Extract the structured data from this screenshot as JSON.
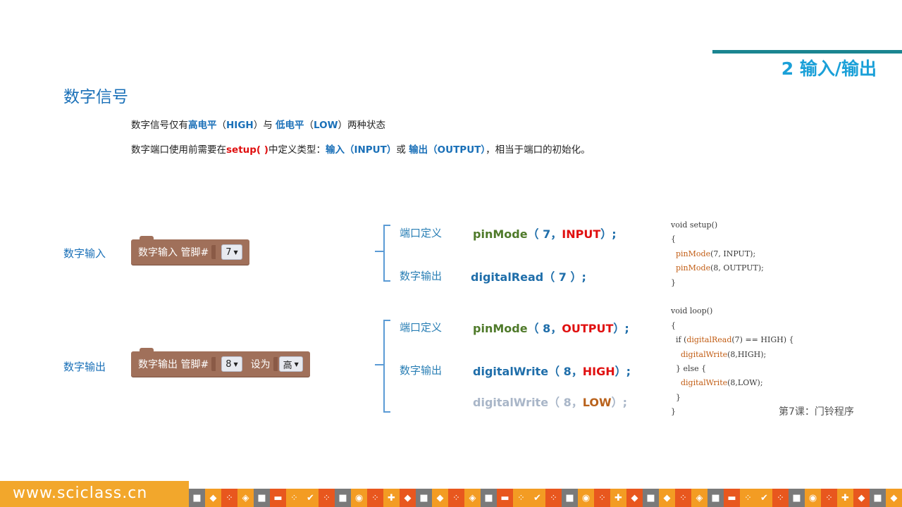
{
  "header": {
    "section": "2 输入/输出",
    "title": "数字信号"
  },
  "paragraphs": {
    "p1": {
      "a": "数字信号仅有",
      "b": "高电平",
      "c": "（",
      "d": "HIGH",
      "e": "）与 ",
      "f": "低电平",
      "g": "（",
      "h": "LOW",
      "i": "）两种状态"
    },
    "p2": {
      "a": "数字端口使用前需要在",
      "b": "setup( )",
      "c": "中定义类型：",
      "d": "输入（INPUT）",
      "e": "或 ",
      "f": "输出（OUTPUT）",
      "g": "，相当于端口的初始化。"
    }
  },
  "input_row": {
    "label": "数字输入",
    "block_text": "数字输入 管脚#",
    "pin": "7",
    "def_label": "端口定义",
    "def_code": {
      "fn": "pinMode",
      "open": "（ 7，",
      "arg": "INPUT",
      "close": "）;"
    },
    "io_label": "数字输出",
    "io_code": {
      "fn": "digitalRead",
      "rest": "（ 7 ）;"
    }
  },
  "output_row": {
    "label": "数字输出",
    "block_text": "数字输出 管脚#",
    "pin": "8",
    "set_text": "设为",
    "value": "高",
    "def_label": "端口定义",
    "def_code": {
      "fn": "pinMode",
      "open": "（ 8，",
      "arg": "OUTPUT",
      "close": "）;"
    },
    "io_label": "数字输出",
    "io_code": {
      "fn": "digitalWrite",
      "open": "（ 8，",
      "arg": "HIGH",
      "close": "）;"
    },
    "io_code2": {
      "fn": "digitalWrite",
      "open": "（ 8，",
      "arg": "LOW",
      "close": "）;"
    }
  },
  "code_panel": {
    "l1": "void setup()",
    "l2": "{",
    "l3a": "  ",
    "l3fn": "pinMode",
    "l3b": "(7, INPUT);",
    "l4a": "  ",
    "l4fn": "pinMode",
    "l4b": "(8, OUTPUT);",
    "l5": "}",
    "l6": "",
    "l7": "void loop()",
    "l8": "{",
    "l9a": "  if (",
    "l9fn": "digitalRead",
    "l9b": "(7) == HIGH) {",
    "l10a": "    ",
    "l10fn": "digitalWrite",
    "l10b": "(8,HIGH);",
    "l11": "  } else {",
    "l12a": "    ",
    "l12fn": "digitalWrite",
    "l12b": "(8,LOW);",
    "l13": "  }",
    "l14": "}"
  },
  "lesson": "第7课：门铃程序",
  "footer": {
    "site": "www.sciclass.cn"
  },
  "colors": {
    "accent": "#1aa0d8",
    "title_blue": "#1a70b8",
    "red": "#e01010",
    "green": "#4f7a2a",
    "block": "#a0705a",
    "footer_orange": "#f2a72c"
  }
}
